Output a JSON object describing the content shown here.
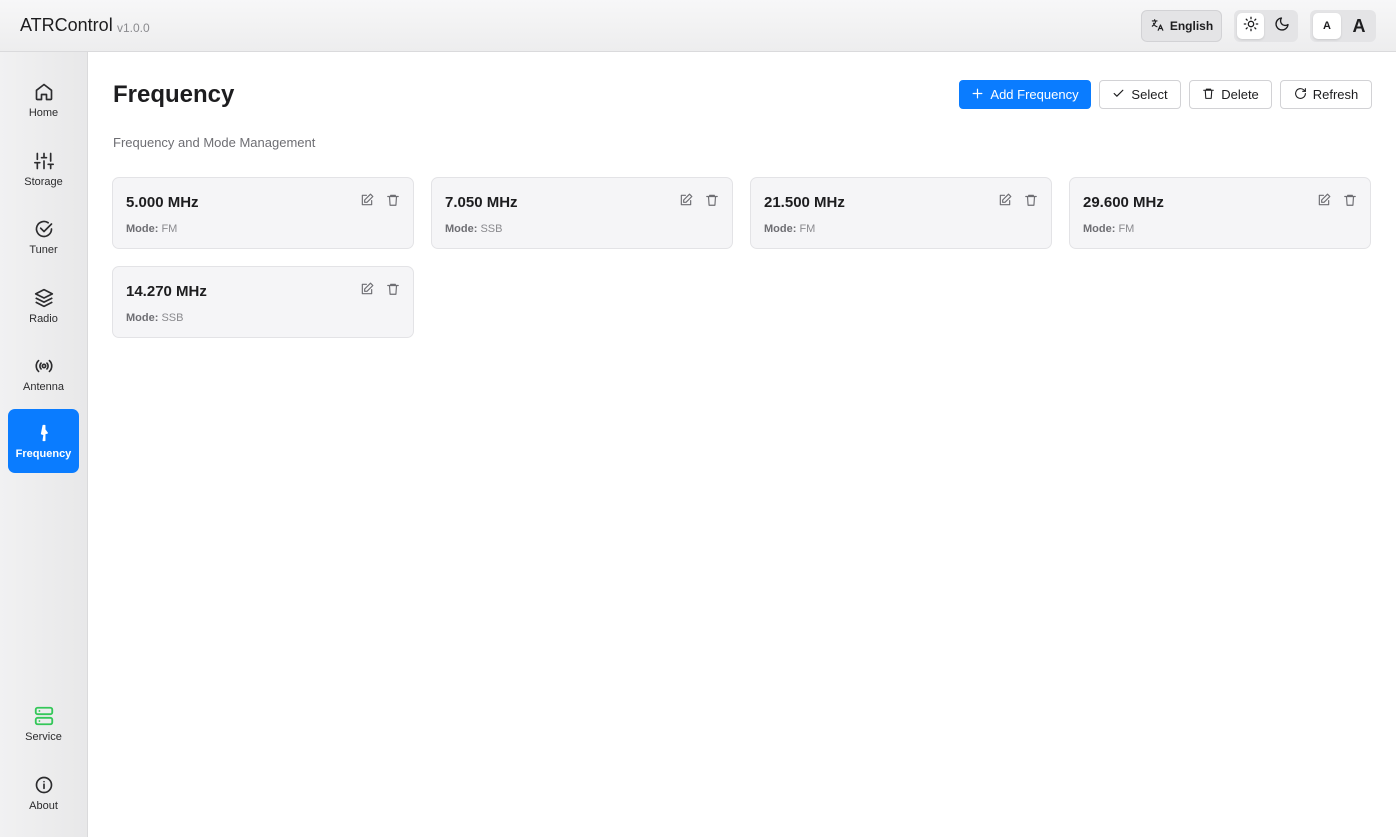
{
  "header": {
    "app_title": "ATRControl",
    "version": "v1.0.0",
    "language": "English",
    "font_small": "A",
    "font_large": "A"
  },
  "sidebar": {
    "items": [
      {
        "label": "Home",
        "icon": "home-icon"
      },
      {
        "label": "Storage",
        "icon": "sliders-icon"
      },
      {
        "label": "Tuner",
        "icon": "check-circle-icon"
      },
      {
        "label": "Radio",
        "icon": "layers-icon"
      },
      {
        "label": "Antenna",
        "icon": "antenna-icon"
      },
      {
        "label": "Frequency",
        "icon": "frequency-icon",
        "active": true
      }
    ],
    "bottom_items": [
      {
        "label": "Service",
        "icon": "server-icon"
      },
      {
        "label": "About",
        "icon": "info-icon"
      }
    ]
  },
  "main": {
    "title": "Frequency",
    "subtitle": "Frequency and Mode Management",
    "actions": {
      "add": "Add Frequency",
      "select": "Select",
      "delete": "Delete",
      "refresh": "Refresh"
    },
    "mode_label": "Mode:",
    "frequencies": [
      {
        "freq": "5.000 MHz",
        "mode": "FM"
      },
      {
        "freq": "7.050 MHz",
        "mode": "SSB"
      },
      {
        "freq": "21.500 MHz",
        "mode": "FM"
      },
      {
        "freq": "29.600 MHz",
        "mode": "FM"
      },
      {
        "freq": "14.270 MHz",
        "mode": "SSB"
      }
    ]
  },
  "colors": {
    "accent": "#0a7cff",
    "service_icon": "#34c759"
  }
}
